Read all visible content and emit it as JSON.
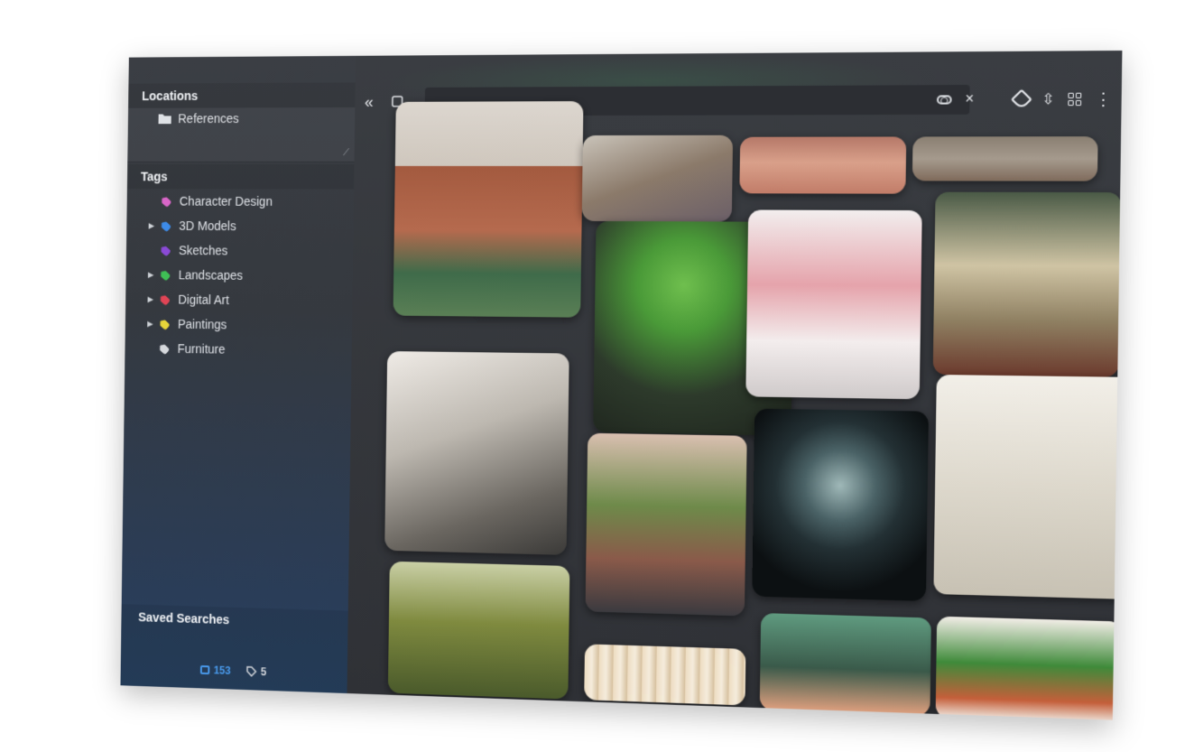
{
  "sidebar": {
    "locations_header": "Locations",
    "locations": [
      {
        "label": "References",
        "icon": "folder-icon"
      }
    ],
    "tags_header": "Tags",
    "tags": [
      {
        "label": "Character Design",
        "color": "#d966c8",
        "expandable": false
      },
      {
        "label": "3D Models",
        "color": "#3d8be8",
        "expandable": true
      },
      {
        "label": "Sketches",
        "color": "#8a4ad6",
        "expandable": false
      },
      {
        "label": "Landscapes",
        "color": "#3fbf55",
        "expandable": true
      },
      {
        "label": "Digital Art",
        "color": "#e04455",
        "expandable": true
      },
      {
        "label": "Paintings",
        "color": "#e8d63a",
        "expandable": true
      },
      {
        "label": "Furniture",
        "color": "#d5d8dc",
        "expandable": false
      }
    ],
    "saved_searches_header": "Saved Searches",
    "status": {
      "images_count": "153",
      "tags_count": "5"
    }
  },
  "toolbar": {
    "collapse_icon": "double-chevron-left-icon",
    "clear_symbol": "×",
    "menu_symbol": "⋮",
    "collapse_symbol": "«",
    "sort_symbol": "⇳"
  },
  "gallery": {
    "tiles": [
      {
        "subject": "industrial-building",
        "colors": [
          "#d9d3cc",
          "#a35a3f",
          "#3f6b4a"
        ]
      },
      {
        "subject": "figure-and-bridge",
        "colors": [
          "#c9c3b9",
          "#8b7a6a",
          "#6b5f68"
        ]
      },
      {
        "subject": "pink-landscape",
        "colors": [
          "#d9a08a",
          "#c17c68",
          "#5d4a4a"
        ]
      },
      {
        "subject": "rocky-landscape",
        "colors": [
          "#a59a8d",
          "#7f6b5b",
          "#b7b2aa"
        ]
      },
      {
        "subject": "tree-frog",
        "colors": [
          "#2d3a2b",
          "#5fa84a",
          "#d9402a"
        ]
      },
      {
        "subject": "train-sketch",
        "colors": [
          "#f2eeee",
          "#e5a3ab",
          "#7f7f7f"
        ]
      },
      {
        "subject": "church-interior",
        "colors": [
          "#3b4a39",
          "#cfc4a4",
          "#6b3a2d"
        ]
      },
      {
        "subject": "pencil-portrait",
        "colors": [
          "#efebe6",
          "#8a857f",
          "#3b3a38"
        ]
      },
      {
        "subject": "plant-room",
        "colors": [
          "#e0c6b8",
          "#6e8a4a",
          "#3b3a3f"
        ]
      },
      {
        "subject": "glowing-bust",
        "colors": [
          "#0c1012",
          "#9fb8b8",
          "#233034"
        ]
      },
      {
        "subject": "perspective-sketch",
        "colors": [
          "#f2efe8",
          "#b7b2a5",
          "#8a857a"
        ]
      },
      {
        "subject": "jungle-ruin",
        "colors": [
          "#7f8a3f",
          "#4a5a2b",
          "#c9cfa5"
        ]
      },
      {
        "subject": "curtain",
        "colors": [
          "#eddcc1",
          "#d5bf9d",
          "#f5ecdc"
        ]
      },
      {
        "subject": "girl-portrait",
        "colors": [
          "#5f9a7f",
          "#3a5a4a",
          "#e0a07f"
        ]
      },
      {
        "subject": "plant-character",
        "colors": [
          "#f1ede6",
          "#3f8a3a",
          "#c45f3a"
        ]
      }
    ]
  }
}
